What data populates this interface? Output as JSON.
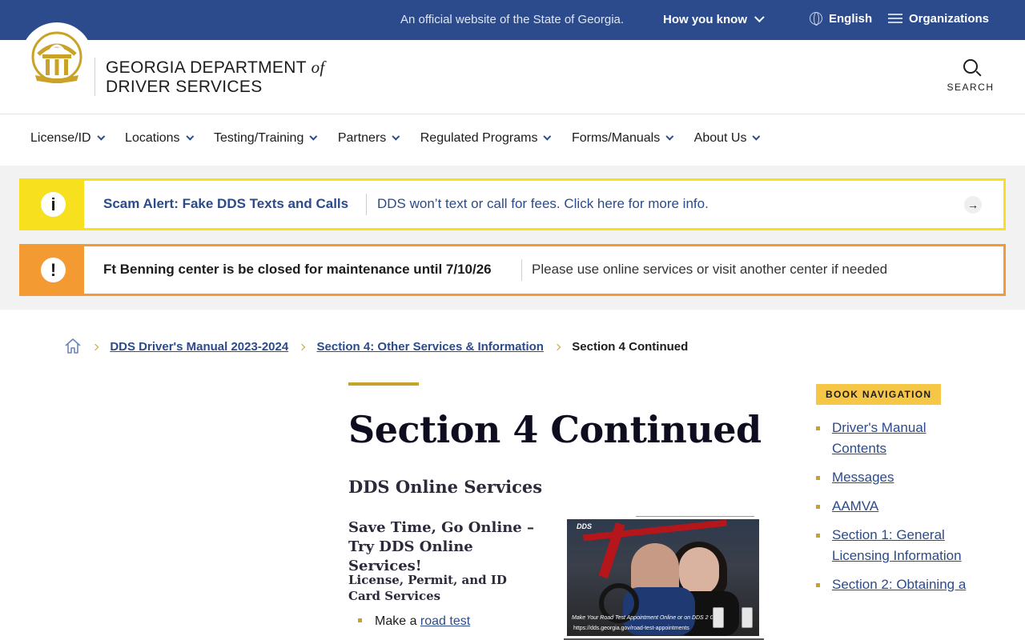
{
  "topbar": {
    "official": "An official website of the State of Georgia.",
    "how_you_know": "How you know",
    "language": "English",
    "organizations": "Organizations"
  },
  "header": {
    "brand_line1": "GEORGIA DEPARTMENT",
    "brand_of": "of",
    "brand_line2": "DRIVER SERVICES",
    "search_label": "SEARCH"
  },
  "nav": {
    "items": [
      "License/ID",
      "Locations",
      "Testing/Training",
      "Partners",
      "Regulated Programs",
      "Forms/Manuals",
      "About Us"
    ]
  },
  "alerts": [
    {
      "icon": "i",
      "title": "Scam Alert: Fake DDS Texts and Calls",
      "message": "DDS won’t text or call for fees. Click here for more info.",
      "color": "#f7e11f"
    },
    {
      "icon": "!",
      "title": "Ft Benning center is be closed for maintenance until 7/10/26",
      "message": "Please use online services or visit another center if needed",
      "color": "#f39a33"
    }
  ],
  "breadcrumb": {
    "items": [
      "DDS Driver's Manual 2023-2024",
      "Section 4: Other Services & Information"
    ],
    "current": "Section 4 Continued"
  },
  "main": {
    "title": "Section 4 Continued",
    "h2": "DDS Online Services",
    "h3": "Save Time, Go Online – Try DDS Online Services!",
    "h4": "License, Permit, and ID Card Services",
    "bullet1_prefix": "Make a ",
    "bullet1_link": "road test"
  },
  "promo": {
    "logo": "DDS",
    "caption": "Make Your Road Test Appointment Online or on DDS 2 GO!",
    "url": "https://dds.georgia.gov/road-test-appointments"
  },
  "sidebar": {
    "heading": "BOOK NAVIGATION",
    "items": [
      "Driver's Manual Contents",
      "Messages",
      "AAMVA",
      "Section 1: General Licensing Information",
      "Section 2: Obtaining a"
    ]
  },
  "colors": {
    "brand_blue": "#2b4b8c",
    "gold": "#c9a227",
    "alert_yellow": "#f7e11f",
    "alert_orange": "#f39a33"
  }
}
